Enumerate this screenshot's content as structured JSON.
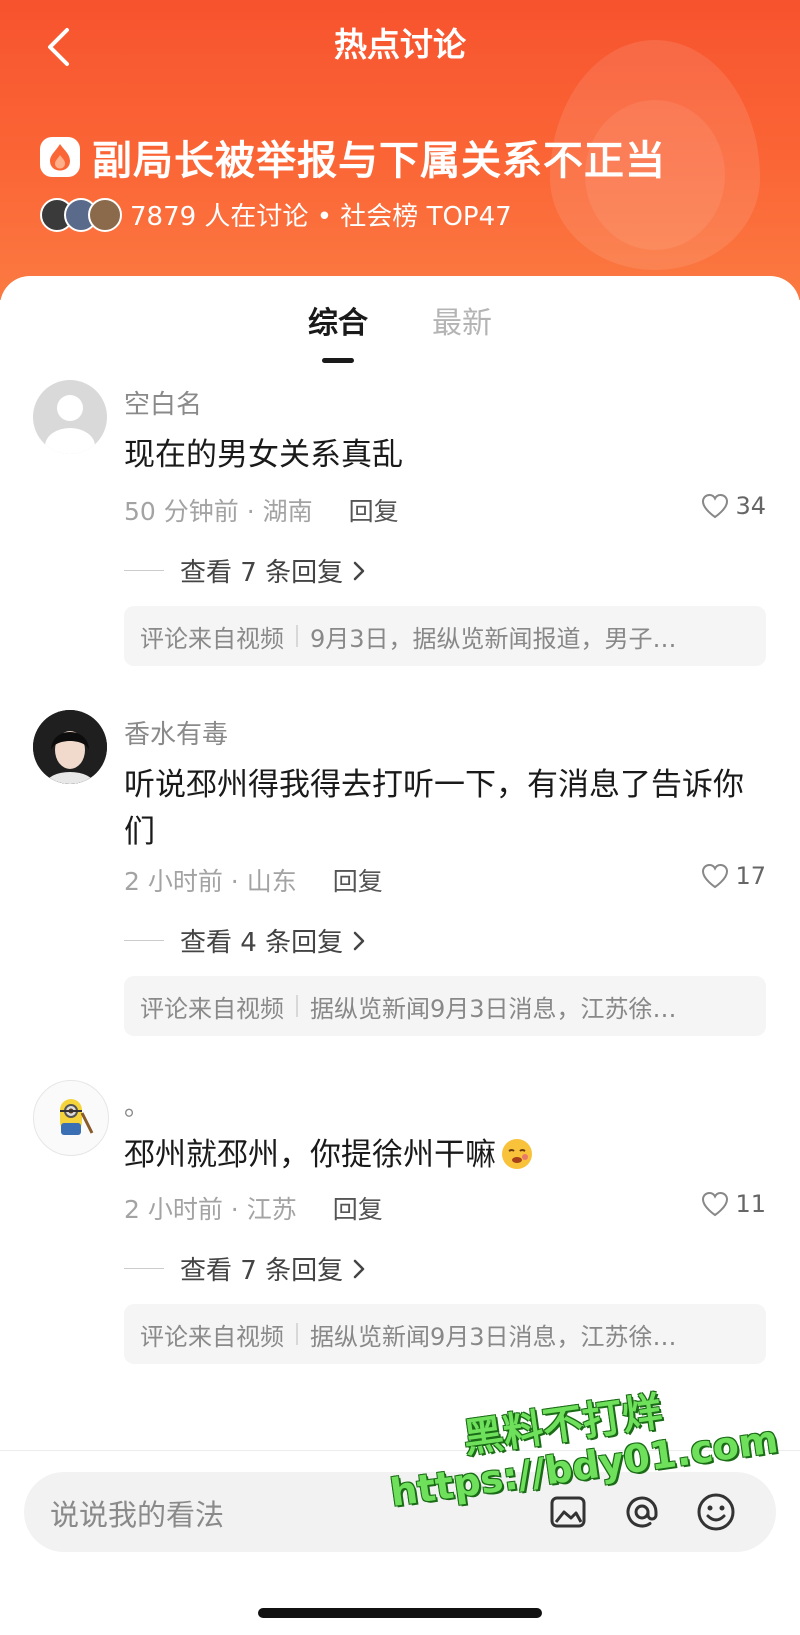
{
  "header": {
    "title": "热点讨论",
    "topic_title": "副局长被举报与下属关系不正当",
    "meta": "7879 人在讨论 • 社会榜 TOP47"
  },
  "tabs": [
    {
      "label": "综合",
      "active": true
    },
    {
      "label": "最新",
      "active": false
    }
  ],
  "comments": [
    {
      "name": "空白名",
      "text": "现在的男女关系真乱",
      "time_loc": "50 分钟前 · 湖南",
      "reply_label": "回复",
      "likes": "34",
      "view_replies": "查看 7 条回复",
      "source_label": "评论来自视频",
      "source_text": "9月3日，据纵览新闻报道，男子…"
    },
    {
      "name": "香水有毒",
      "text": "听说邳州得我得去打听一下，有消息了告诉你们",
      "time_loc": "2 小时前 · 山东",
      "reply_label": "回复",
      "likes": "17",
      "view_replies": "查看 4 条回复",
      "source_label": "评论来自视频",
      "source_text": "据纵览新闻9月3日消息，江苏徐…"
    },
    {
      "name": "。",
      "text": "邳州就邳州，你提徐州干嘛",
      "time_loc": "2 小时前 · 江苏",
      "reply_label": "回复",
      "likes": "11",
      "view_replies": "查看 7 条回复",
      "source_label": "评论来自视频",
      "source_text": "据纵览新闻9月3日消息，江苏徐…"
    }
  ],
  "input": {
    "placeholder": "说说我的看法"
  },
  "watermark": {
    "line1": "黑料不打烊",
    "line2": "https://bdy01.com"
  },
  "colors": {
    "header_bg": "#f7532e",
    "watermark_green": "#6fe05b"
  },
  "icons": {
    "back": "chevron-left-icon",
    "topic": "flame-icon",
    "like": "heart-outline-icon",
    "emoji": "smiley-icon",
    "mention": "at-icon",
    "image": "image-icon"
  }
}
